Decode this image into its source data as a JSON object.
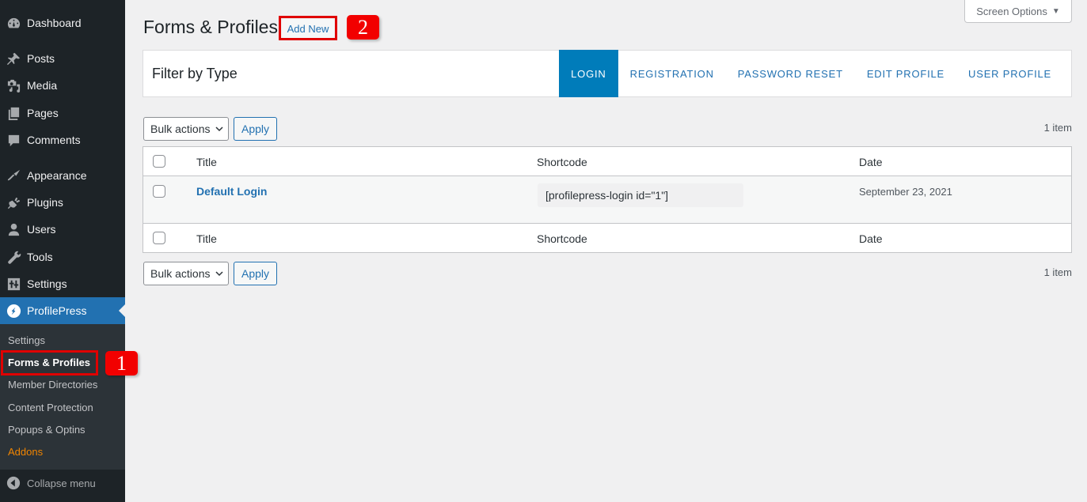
{
  "sidebar": {
    "items": [
      {
        "label": "Dashboard",
        "icon": "dashboard-icon"
      },
      {
        "label": "Posts",
        "icon": "pin-icon"
      },
      {
        "label": "Media",
        "icon": "media-icon"
      },
      {
        "label": "Pages",
        "icon": "pages-icon"
      },
      {
        "label": "Comments",
        "icon": "comment-icon"
      },
      {
        "label": "Appearance",
        "icon": "paintbrush-icon"
      },
      {
        "label": "Plugins",
        "icon": "plugin-icon"
      },
      {
        "label": "Users",
        "icon": "user-icon"
      },
      {
        "label": "Tools",
        "icon": "wrench-icon"
      },
      {
        "label": "Settings",
        "icon": "settings-icon"
      },
      {
        "label": "ProfilePress",
        "icon": "profilepress-icon",
        "active": true
      }
    ],
    "submenu": [
      {
        "label": "Settings"
      },
      {
        "label": "Forms & Profiles",
        "current": true
      },
      {
        "label": "Member Directories"
      },
      {
        "label": "Content Protection"
      },
      {
        "label": "Popups & Optins"
      },
      {
        "label": "Addons",
        "highlight": true
      }
    ],
    "collapse_label": "Collapse menu"
  },
  "header": {
    "title": "Forms & Profiles",
    "add_new_label": "Add New",
    "screen_options_label": "Screen Options",
    "screen_options_arrow": "▼"
  },
  "filter": {
    "title": "Filter by Type",
    "tabs": [
      {
        "label": "LOGIN",
        "active": true
      },
      {
        "label": "REGISTRATION"
      },
      {
        "label": "PASSWORD RESET"
      },
      {
        "label": "EDIT PROFILE"
      },
      {
        "label": "USER PROFILE"
      }
    ]
  },
  "tablenav": {
    "bulk_actions_label": "Bulk actions",
    "apply_label": "Apply",
    "item_count": "1 item"
  },
  "table": {
    "columns": [
      "Title",
      "Shortcode",
      "Date"
    ],
    "rows": [
      {
        "title": "Default Login",
        "shortcode": "[profilepress-login id=\"1\"]",
        "date": "September 23, 2021"
      }
    ]
  },
  "annotations": {
    "badge_1": "1",
    "badge_2": "2",
    "color": "#f20000"
  },
  "colors": {
    "sidebar_bg": "#1d2327",
    "submenu_bg": "#2c3338",
    "active_menu": "#2271b1",
    "active_tab": "#007cba",
    "link": "#2271b1",
    "addons": "#f18500"
  }
}
